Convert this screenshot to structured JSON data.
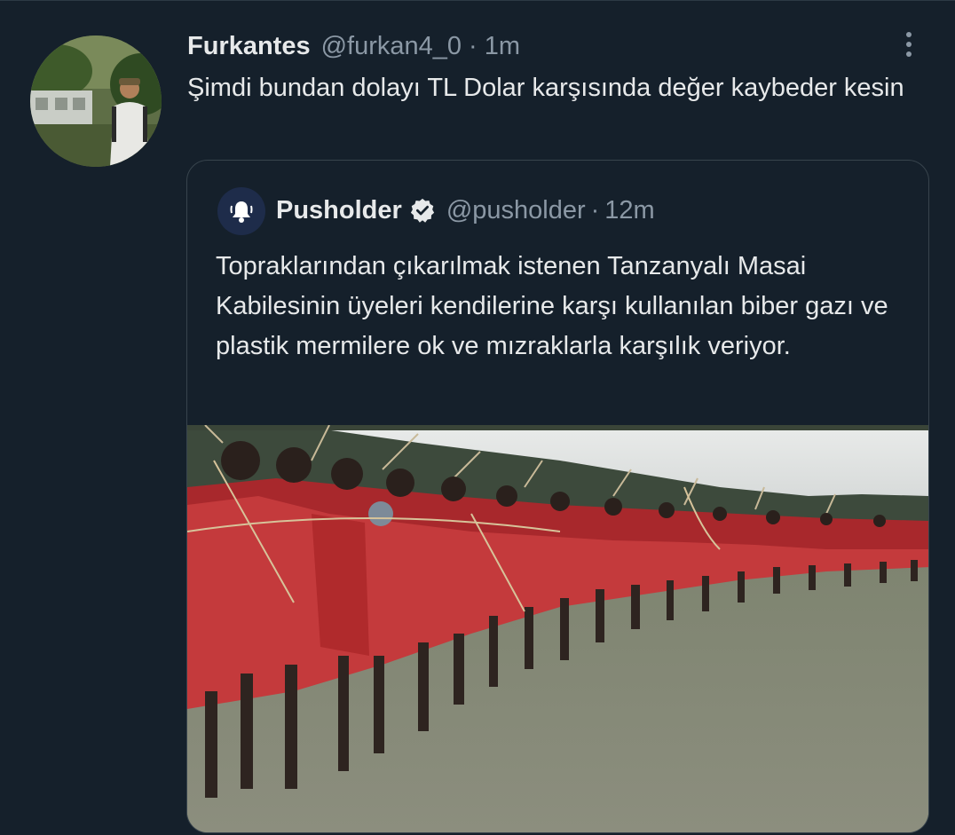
{
  "tweet": {
    "display_name": "Furkantes",
    "handle": "@furkan4_0",
    "separator": "·",
    "time": "1m",
    "text": "Şimdi bundan dolayı TL Dolar karşısında değer kaybeder kesin",
    "avatar_icon": "profile-photo"
  },
  "quote": {
    "display_name": "Pusholder",
    "handle": "@pusholder",
    "separator": "·",
    "time": "12m",
    "verified_icon": "verified-badge-icon",
    "avatar_icon": "bell-icon",
    "text": "Topraklarından çıkarılmak istenen Tanzanyalı Masai Kabilesinin üyeleri kendilerine karşı kullanılan biber gazı ve plastik mermilere ok ve mızraklarla karşılık veriyor.",
    "media_icon": "photo-masai-archers"
  },
  "colors": {
    "background": "#15202b",
    "primary_text": "#e7e9ea",
    "secondary_text": "#8b98a5",
    "border": "#38444d",
    "accent_red": "#c0312f"
  }
}
